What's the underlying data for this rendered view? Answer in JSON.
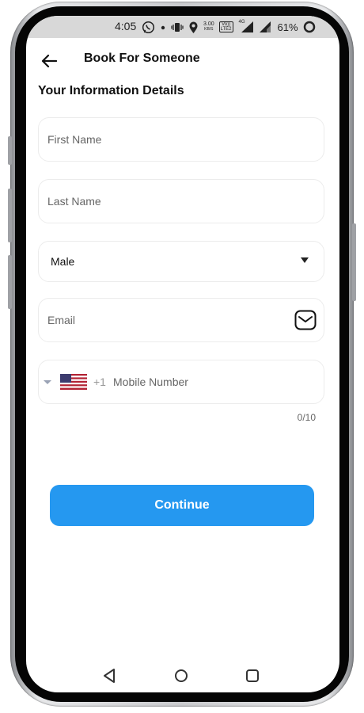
{
  "status_bar": {
    "time": "4:05",
    "speed_value": "3.00",
    "speed_unit": "KB/S",
    "volte_top": "Vo))",
    "volte_bottom": "LTE2",
    "network_type": "4G",
    "battery_percent": "61%"
  },
  "header": {
    "title": "Book For Someone"
  },
  "section": {
    "title": "Your Information Details"
  },
  "form": {
    "first_name": {
      "value": "",
      "placeholder": "First Name"
    },
    "last_name": {
      "value": "",
      "placeholder": "Last Name"
    },
    "gender": {
      "selected": "Male"
    },
    "email": {
      "value": "",
      "placeholder": "Email"
    },
    "mobile": {
      "country_flag": "us-flag-icon",
      "dial_code": "+1",
      "value": "",
      "placeholder": "Mobile Number",
      "counter": "0/10"
    }
  },
  "actions": {
    "continue_label": "Continue"
  },
  "icons": {
    "back": "arrow-left-icon",
    "email": "mail-icon",
    "nav_back": "triangle-back-icon",
    "nav_home": "circle-home-icon",
    "nav_recents": "square-recents-icon"
  },
  "colors": {
    "accent": "#2598f0",
    "field_border": "#ececec",
    "status_bar_bg": "#d8d8d8"
  }
}
